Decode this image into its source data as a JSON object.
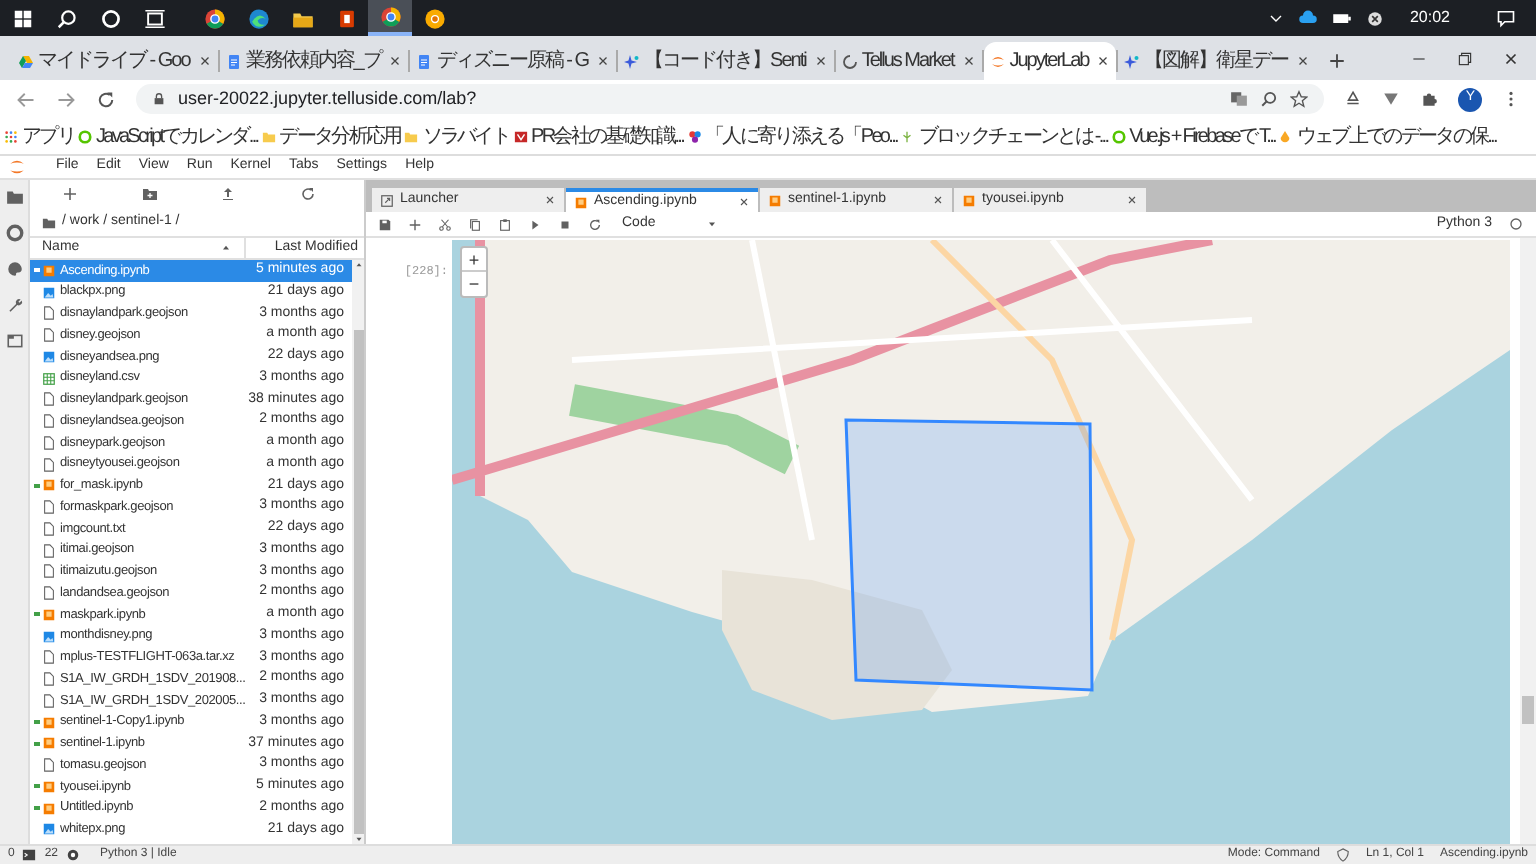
{
  "taskbar": {
    "apps": [
      {
        "kind": "windows",
        "selected": false
      },
      {
        "kind": "search",
        "selected": false
      },
      {
        "kind": "cortana",
        "selected": false
      },
      {
        "kind": "taskview",
        "selected": false
      },
      {
        "kind": "chrome",
        "selected": false
      },
      {
        "kind": "edge",
        "selected": false
      },
      {
        "kind": "explorer",
        "selected": false
      },
      {
        "kind": "office",
        "selected": false
      },
      {
        "kind": "chrome",
        "selected": true
      },
      {
        "kind": "chrome-canary",
        "selected": false
      }
    ],
    "clock": "20:02"
  },
  "browser_tabs": [
    {
      "kind": "drive",
      "label": "マイドライブ - Goo",
      "selected": false
    },
    {
      "kind": "docs",
      "label": "業務依頼内容_プ",
      "selected": false
    },
    {
      "kind": "docs",
      "label": "ディズニー原稿 - G",
      "selected": false
    },
    {
      "kind": "sparkle",
      "label": "【コード付き】Senti",
      "selected": false
    },
    {
      "kind": "spinner",
      "label": "Tellus Market",
      "selected": false
    },
    {
      "kind": "jupyter",
      "label": "JupyterLab",
      "selected": true
    },
    {
      "kind": "sparkle",
      "label": "【図解】衛星デー",
      "selected": false
    }
  ],
  "address_bar": {
    "url": "user-20022.jupyter.telluside.com/lab?",
    "profile": "Y"
  },
  "bookmarks": [
    {
      "kind": "apps",
      "label": "アプリ"
    },
    {
      "kind": "green-circle",
      "label": "JavaScriptでカレンダ..."
    },
    {
      "kind": "folder",
      "label": "データ分析応用"
    },
    {
      "kind": "folder",
      "label": "ソラバイト"
    },
    {
      "kind": "red-logo",
      "label": "PR会社の基礎知識..."
    },
    {
      "kind": "flower",
      "label": "「人に寄り添える「Peo..."
    },
    {
      "kind": "leaf",
      "label": "ブロックチェーンとは -..."
    },
    {
      "kind": "green-circle",
      "label": "Vue.js + Firebaseで T..."
    },
    {
      "kind": "drop",
      "label": "ウェブ上でのデータの保..."
    }
  ],
  "menu": [
    "File",
    "Edit",
    "View",
    "Run",
    "Kernel",
    "Tabs",
    "Settings",
    "Help"
  ],
  "file_browser": {
    "path": "/ work / sentinel-1 /",
    "columns": [
      "Name",
      "Last Modified"
    ],
    "files": [
      {
        "kind": "notebook",
        "name": "Ascending.ipynb",
        "modified": "5 minutes ago",
        "running": true,
        "selected": true
      },
      {
        "kind": "image",
        "name": "blackpx.png",
        "modified": "21 days ago",
        "running": false,
        "selected": false
      },
      {
        "kind": "file",
        "name": "disnaylandpark.geojson",
        "modified": "3 months ago",
        "running": false,
        "selected": false
      },
      {
        "kind": "file",
        "name": "disney.geojson",
        "modified": "a month ago",
        "running": false,
        "selected": false
      },
      {
        "kind": "image",
        "name": "disneyandsea.png",
        "modified": "22 days ago",
        "running": false,
        "selected": false
      },
      {
        "kind": "csv",
        "name": "disneyland.csv",
        "modified": "3 months ago",
        "running": false,
        "selected": false
      },
      {
        "kind": "file",
        "name": "disneylandpark.geojson",
        "modified": "38 minutes ago",
        "running": false,
        "selected": false
      },
      {
        "kind": "file",
        "name": "disneylandsea.geojson",
        "modified": "2 months ago",
        "running": false,
        "selected": false
      },
      {
        "kind": "file",
        "name": "disneypark.geojson",
        "modified": "a month ago",
        "running": false,
        "selected": false
      },
      {
        "kind": "file",
        "name": "disneytyousei.geojson",
        "modified": "a month ago",
        "running": false,
        "selected": false
      },
      {
        "kind": "notebook",
        "name": "for_mask.ipynb",
        "modified": "21 days ago",
        "running": true,
        "selected": false
      },
      {
        "kind": "file",
        "name": "formaskpark.geojson",
        "modified": "3 months ago",
        "running": false,
        "selected": false
      },
      {
        "kind": "file",
        "name": "imgcount.txt",
        "modified": "22 days ago",
        "running": false,
        "selected": false
      },
      {
        "kind": "file",
        "name": "itimai.geojson",
        "modified": "3 months ago",
        "running": false,
        "selected": false
      },
      {
        "kind": "file",
        "name": "itimaizutu.geojson",
        "modified": "3 months ago",
        "running": false,
        "selected": false
      },
      {
        "kind": "file",
        "name": "landandsea.geojson",
        "modified": "2 months ago",
        "running": false,
        "selected": false
      },
      {
        "kind": "notebook",
        "name": "maskpark.ipynb",
        "modified": "a month ago",
        "running": true,
        "selected": false
      },
      {
        "kind": "image",
        "name": "monthdisney.png",
        "modified": "3 months ago",
        "running": false,
        "selected": false
      },
      {
        "kind": "file",
        "name": "mplus-TESTFLIGHT-063a.tar.xz",
        "modified": "3 months ago",
        "running": false,
        "selected": false
      },
      {
        "kind": "file",
        "name": "S1A_IW_GRDH_1SDV_201908...",
        "modified": "2 months ago",
        "running": false,
        "selected": false
      },
      {
        "kind": "file",
        "name": "S1A_IW_GRDH_1SDV_202005...",
        "modified": "3 months ago",
        "running": false,
        "selected": false
      },
      {
        "kind": "notebook",
        "name": "sentinel-1-Copy1.ipynb",
        "modified": "3 months ago",
        "running": true,
        "selected": false
      },
      {
        "kind": "notebook",
        "name": "sentinel-1.ipynb",
        "modified": "37 minutes ago",
        "running": true,
        "selected": false
      },
      {
        "kind": "file",
        "name": "tomasu.geojson",
        "modified": "3 months ago",
        "running": false,
        "selected": false
      },
      {
        "kind": "notebook",
        "name": "tyousei.ipynb",
        "modified": "5 minutes ago",
        "running": true,
        "selected": false
      },
      {
        "kind": "notebook",
        "name": "Untitled.ipynb",
        "modified": "2 months ago",
        "running": true,
        "selected": false
      },
      {
        "kind": "image",
        "name": "whitepx.png",
        "modified": "21 days ago",
        "running": false,
        "selected": false
      }
    ]
  },
  "notebook_tabs": [
    {
      "kind": "launcher",
      "label": "Launcher",
      "selected": false
    },
    {
      "kind": "notebook",
      "label": "Ascending.ipynb",
      "selected": true
    },
    {
      "kind": "notebook",
      "label": "sentinel-1.ipynb",
      "selected": false
    },
    {
      "kind": "notebook",
      "label": "tyousei.ipynb",
      "selected": false
    }
  ],
  "notebook_toolbar": {
    "cell_type": "Code",
    "kernel": "Python 3"
  },
  "cell": {
    "prompt": "[228]:",
    "zoom_in": "+",
    "zoom_out": "−"
  },
  "status_bar": {
    "terminals": "0",
    "kernels": "22",
    "kernel_status": "Python 3 | Idle",
    "mode": "Mode: Command",
    "cursor": "Ln 1, Col 1",
    "file": "Ascending.ipynb"
  }
}
